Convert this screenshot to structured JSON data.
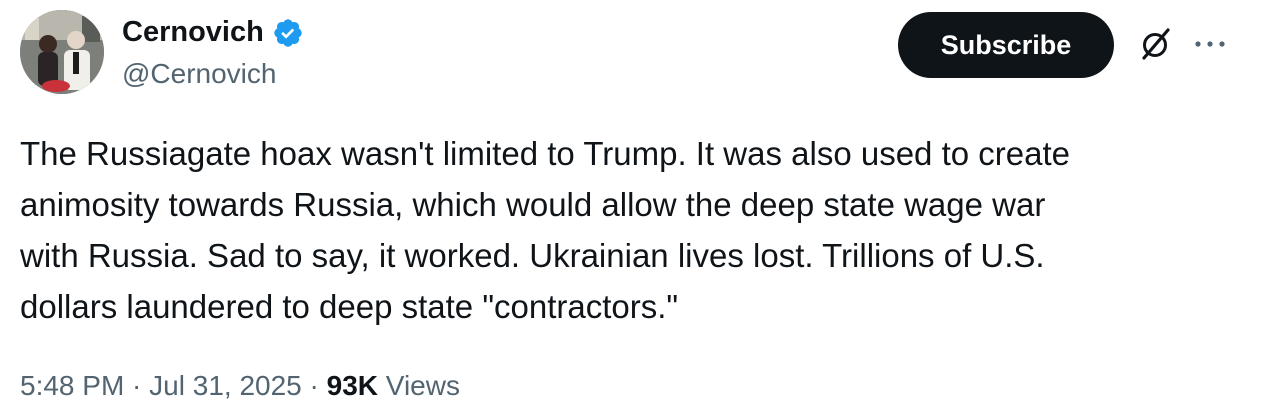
{
  "author": {
    "display_name": "Cernovich",
    "handle": "@Cernovich",
    "verified": true,
    "verified_color": "#1d9bf0"
  },
  "actions": {
    "subscribe_label": "Subscribe",
    "grok_icon": "grok-icon",
    "more_icon": "more-horizontal-icon"
  },
  "tweet": {
    "text": "The Russiagate hoax wasn't limited to Trump. It was also used to create\nanimosity towards Russia, which would allow the deep state wage war\nwith Russia. Sad to say, it worked. Ukrainian lives lost. Trillions of U.S.\ndollars laundered to deep state \"contractors.\""
  },
  "meta": {
    "time": "5:48 PM",
    "separator1": " · ",
    "date": "Jul 31, 2025",
    "separator2": " · ",
    "views_count": "93K",
    "views_label": " Views"
  }
}
